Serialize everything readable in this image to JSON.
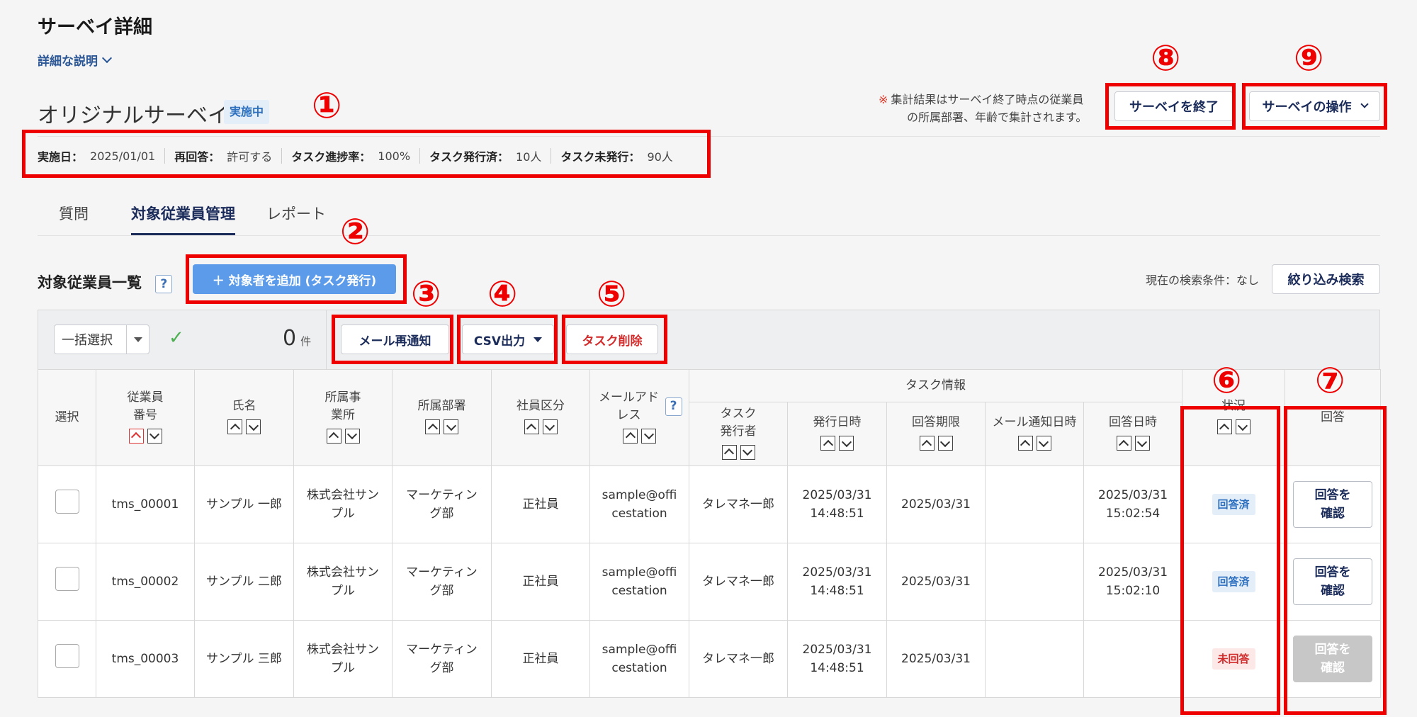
{
  "page": {
    "title": "サーベイ詳細",
    "description_link": "詳細な説明"
  },
  "survey": {
    "name": "オリジナルサーベイ",
    "status": "実施中",
    "info": [
      {
        "label": "実施日：",
        "value": "2025/01/01"
      },
      {
        "label": "再回答：",
        "value": "許可する"
      },
      {
        "label": "タスク進捗率：",
        "value": "100%"
      },
      {
        "label": "タスク発行済：",
        "value": "10人"
      },
      {
        "label": "タスク未発行：",
        "value": "90人"
      }
    ],
    "note_mark": "※",
    "note_line1": "集計結果はサーベイ終了時点の従業員",
    "note_line2": "の所属部署、年齢で集計されます。",
    "end_button": "サーベイを終了",
    "ops_button": "サーベイの操作"
  },
  "tabs": [
    {
      "label": "質問"
    },
    {
      "label": "対象従業員管理"
    },
    {
      "label": "レポート"
    }
  ],
  "list": {
    "title": "対象従業員一覧",
    "help": "?",
    "add_button": "＋ 対象者を追加 (タスク発行)",
    "search_condition": "現在の検索条件：なし",
    "filter_button": "絞り込み検索"
  },
  "toolbar": {
    "bulk_select": "一括選択",
    "checkmark": "✓",
    "count": "0",
    "count_unit": "件",
    "resend_button": "メール再通知",
    "csv_button": "CSV出力",
    "delete_button": "タスク削除"
  },
  "table": {
    "headers": {
      "select": "選択",
      "emp_no": "従業員番号",
      "name": "氏名",
      "office": "所属事業所",
      "dept": "所属部署",
      "emp_type": "社員区分",
      "email": "メールアドレス",
      "task_info": "タスク情報",
      "issuer": "タスク発行者",
      "issued_at": "発行日時",
      "deadline": "回答期限",
      "mail_at": "メール通知日時",
      "answered_at": "回答日時",
      "status": "状況",
      "answer": "回答"
    },
    "rows": [
      {
        "emp_no": "tms_00001",
        "name": "サンプル 一郎",
        "office": "株式会社サンプル",
        "dept": "マーケティング部",
        "type": "正社員",
        "email": "sample@officestation",
        "issuer": "タレマネ一郎",
        "issued": "2025/03/31 14:48:51",
        "deadline": "2025/03/31",
        "mail": "",
        "answered": "2025/03/31 15:02:54",
        "status": "回答済",
        "answer": "回答を確認"
      },
      {
        "emp_no": "tms_00002",
        "name": "サンプル 二郎",
        "office": "株式会社サンプル",
        "dept": "マーケティング部",
        "type": "正社員",
        "email": "sample@officestation",
        "issuer": "タレマネ一郎",
        "issued": "2025/03/31 14:48:51",
        "deadline": "2025/03/31",
        "mail": "",
        "answered": "2025/03/31 15:02:10",
        "status": "回答済",
        "answer": "回答を確認"
      },
      {
        "emp_no": "tms_00003",
        "name": "サンプル 三郎",
        "office": "株式会社サンプル",
        "dept": "マーケティング部",
        "type": "正社員",
        "email": "sample@officestation",
        "issuer": "タレマネ一郎",
        "issued": "2025/03/31 14:48:51",
        "deadline": "2025/03/31",
        "mail": "",
        "answered": "",
        "status": "未回答",
        "answer": "回答を確認"
      }
    ]
  },
  "annotations": [
    "①",
    "②",
    "③",
    "④",
    "⑤",
    "⑥",
    "⑦",
    "⑧",
    "⑨"
  ],
  "colors": {
    "accent": "#5b9bea",
    "navy": "#1b2c5a",
    "highlight": "#ee0000"
  }
}
